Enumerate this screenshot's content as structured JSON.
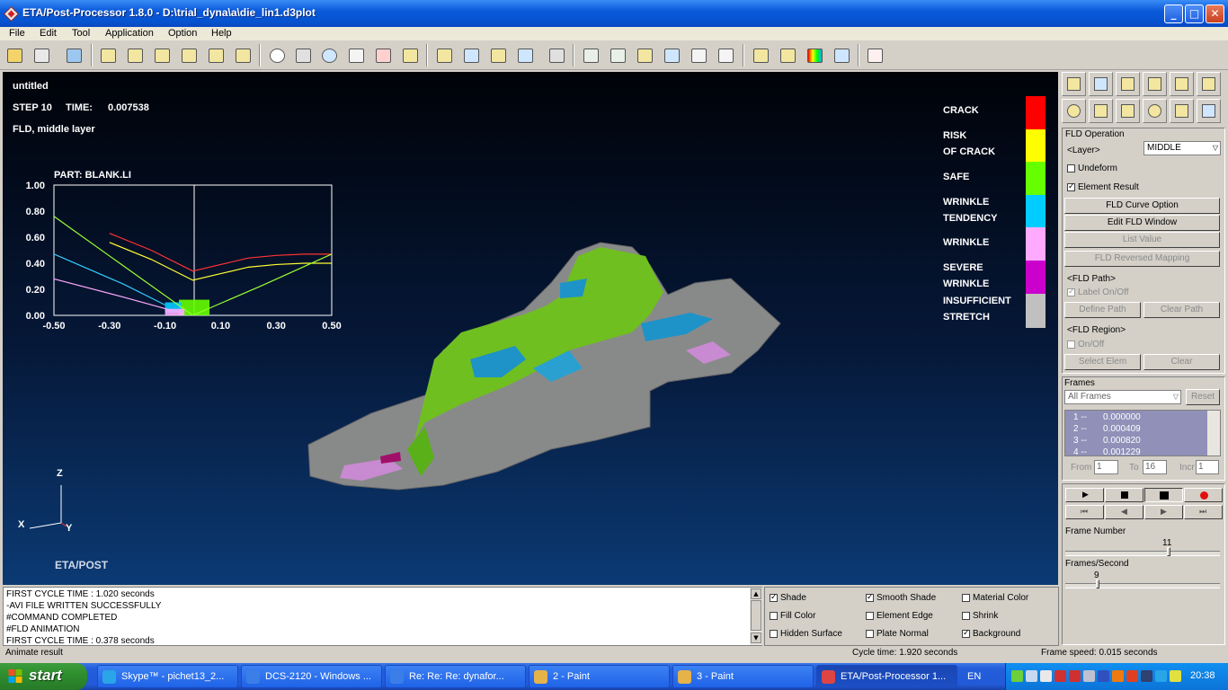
{
  "window": {
    "title": "ETA/Post-Processor 1.8.0 - D:\\trial_dyna\\a\\die_lin1.d3plot",
    "minimize_glyph": "_",
    "maximize_glyph": "□",
    "close_glyph": "✕"
  },
  "menu": [
    "File",
    "Edit",
    "Tool",
    "Application",
    "Option",
    "Help"
  ],
  "viewport": {
    "filename": "untitled",
    "step_label": "STEP 10",
    "time_label": "TIME:",
    "time_value": "0.007538",
    "result_label": "FLD, middle layer",
    "brand": "ETA/POST",
    "axes": {
      "z": "Z",
      "x": "X",
      "y": "Y"
    }
  },
  "legend": {
    "labels": [
      {
        "text": "CRACK"
      },
      {
        "text": "RISK\nOF CRACK"
      },
      {
        "text": "SAFE"
      },
      {
        "text": "WRINKLE\nTENDENCY"
      },
      {
        "text": "WRINKLE"
      },
      {
        "text": "SEVERE\nWRINKLE"
      },
      {
        "text": "INSUFFICIENT\nSTRETCH"
      }
    ],
    "colors": [
      "#ff0000",
      "#ffff00",
      "#66ff00",
      "#00ccff",
      "#ffaaff",
      "#cc00cc",
      "#c0c0c0"
    ]
  },
  "chart_data": {
    "type": "line",
    "title": "PART:  BLANK.LI",
    "xlabel": "",
    "ylabel": "",
    "xlim": [
      -0.5,
      0.5
    ],
    "ylim": [
      0.0,
      1.0
    ],
    "x_ticks": [
      "-0.50",
      "-0.30",
      "-0.10",
      "0.10",
      "0.30",
      "0.50"
    ],
    "y_ticks": [
      "1.00",
      "0.80",
      "0.60",
      "0.40",
      "0.20",
      "0.00"
    ],
    "series": [
      {
        "color": "#ff3333",
        "x": [
          -0.3,
          -0.15,
          0.0,
          0.1,
          0.2,
          0.3,
          0.4,
          0.5
        ],
        "y": [
          0.63,
          0.5,
          0.34,
          0.39,
          0.44,
          0.46,
          0.47,
          0.47
        ]
      },
      {
        "color": "#ffff33",
        "x": [
          -0.3,
          -0.15,
          0.0,
          0.1,
          0.2,
          0.3,
          0.4,
          0.5
        ],
        "y": [
          0.56,
          0.43,
          0.27,
          0.32,
          0.37,
          0.39,
          0.4,
          0.4
        ]
      },
      {
        "color": "#99ff33",
        "x": [
          -0.5,
          -0.25,
          0.0,
          0.25,
          0.5
        ],
        "y": [
          0.76,
          0.38,
          0.0,
          0.23,
          0.47
        ]
      },
      {
        "color": "#33ccff",
        "x": [
          -0.5,
          -0.25,
          -0.1
        ],
        "y": [
          0.47,
          0.24,
          0.08
        ]
      },
      {
        "color": "#ffaaff",
        "x": [
          -0.5,
          -0.25,
          -0.08
        ],
        "y": [
          0.28,
          0.14,
          0.04
        ]
      }
    ],
    "scatter_clusters": [
      {
        "color": "#66ff00",
        "x": [
          -0.05,
          0.06
        ],
        "y": [
          0.0,
          0.12
        ]
      },
      {
        "color": "#00ccff",
        "x": [
          -0.1,
          -0.04
        ],
        "y": [
          0.02,
          0.1
        ]
      },
      {
        "color": "#ffaaff",
        "x": [
          -0.1,
          -0.03
        ],
        "y": [
          0.0,
          0.05
        ]
      }
    ]
  },
  "right_panel": {
    "section_title": "FLD Operation",
    "layer_label": "<Layer>",
    "layer_value": "MIDDLE",
    "undeform_label": "Undeform",
    "undeform_checked": "",
    "element_result_label": "Element Result",
    "element_result_checked": "✓",
    "fld_curve_option": "FLD Curve Option",
    "edit_fld_window": "Edit FLD Window",
    "list_value": "List Value",
    "fld_reversed_mapping": "FLD Reversed Mapping",
    "fld_path_label": "<FLD Path>",
    "label_on_off": "Label On/Off",
    "label_on_off_checked": "✓",
    "define_path": "Define Path",
    "clear_path": "Clear Path",
    "fld_region_label": "<FLD Region>",
    "region_on_off": "On/Off",
    "select_elem": "Select Elem",
    "clear": "Clear",
    "frames_title": "Frames",
    "frames_combo": "All Frames",
    "reset": "Reset",
    "frames_list": [
      {
        "index": "1 --",
        "time": "0.000000"
      },
      {
        "index": "2 --",
        "time": "0.000409"
      },
      {
        "index": "3 --",
        "time": "0.000820"
      },
      {
        "index": "4 --",
        "time": "0.001229"
      }
    ],
    "from_label": "From",
    "from_value": "1",
    "to_label": "To",
    "to_value": "16",
    "incr_label": "Incr",
    "incr_value": "1",
    "frame_number_label": "Frame Number",
    "frame_number_value": "11",
    "frame_number_fraction": 0.67,
    "frames_per_second_label": "Frames/Second",
    "frames_per_second_value": "9",
    "fps_fraction": 0.2
  },
  "console": {
    "lines": [
      "FIRST CYCLE TIME :  1.020 seconds",
      "-AVI FILE WRITTEN SUCCESSFULLY",
      "#COMMAND COMPLETED",
      "#FLD ANIMATION",
      "FIRST CYCLE TIME :  0.378 seconds"
    ]
  },
  "shade_options": [
    {
      "label": "Shade",
      "checked": "✓"
    },
    {
      "label": "Smooth Shade",
      "checked": "✓"
    },
    {
      "label": "Material Color",
      "checked": ""
    },
    {
      "label": "Fill Color",
      "checked": ""
    },
    {
      "label": "Element Edge",
      "checked": ""
    },
    {
      "label": "Shrink",
      "checked": ""
    },
    {
      "label": "Hidden Surface",
      "checked": ""
    },
    {
      "label": "Plate Normal",
      "checked": ""
    },
    {
      "label": "Background",
      "checked": "✓"
    }
  ],
  "status": {
    "left": "Animate result",
    "cycle": "Cycle time:  1.920 seconds",
    "frame_speed": "Frame speed:  0.015 seconds"
  },
  "taskbar": {
    "start": "start",
    "tasks": [
      {
        "label": "Skype™ - pichet13_2...",
        "icon_color": "#2aa5e8"
      },
      {
        "label": "DCS-2120 - Windows ...",
        "icon_color": "#3b7ee8"
      },
      {
        "label": "Re: Re: Re: dynafor...",
        "icon_color": "#3b7ee8"
      },
      {
        "label": "2 - Paint",
        "icon_color": "#e6b24a"
      },
      {
        "label": "3 - Paint",
        "icon_color": "#e6b24a"
      },
      {
        "label": "ETA/Post-Processor 1...",
        "icon_color": "#d44"
      }
    ],
    "lang": "EN",
    "clock": "20:38"
  }
}
